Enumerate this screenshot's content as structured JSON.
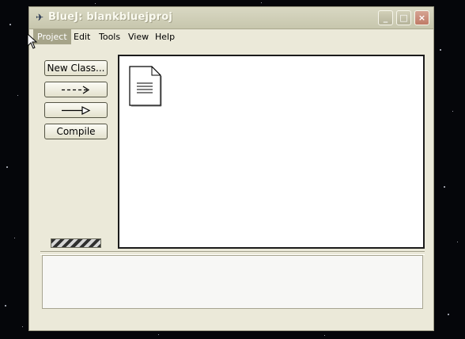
{
  "window": {
    "title": "BlueJ:  blankbluejproj",
    "app_icon": "bluej-bird-icon"
  },
  "title_buttons": [
    "minimize-icon",
    "maximize-icon",
    "close-icon"
  ],
  "menu": {
    "items": [
      {
        "label": "Project",
        "active": true
      },
      {
        "label": "Edit",
        "active": false
      },
      {
        "label": "Tools",
        "active": false
      },
      {
        "label": "View",
        "active": false
      },
      {
        "label": "Help",
        "active": false
      }
    ]
  },
  "toolbar": {
    "new_class_label": "New Class...",
    "dependency_arrow_icon": "dashed-arrow-icon",
    "inheritance_arrow_icon": "inheritance-arrow-icon",
    "compile_label": "Compile"
  },
  "class_diagram": {
    "items": [
      {
        "icon": "readme-document-icon"
      }
    ]
  },
  "message_area": {
    "text": ""
  },
  "colors": {
    "window_bg": "#ebe9d9",
    "menu_active_bg": "#a6a489",
    "canvas_bg": "#ffffff"
  }
}
